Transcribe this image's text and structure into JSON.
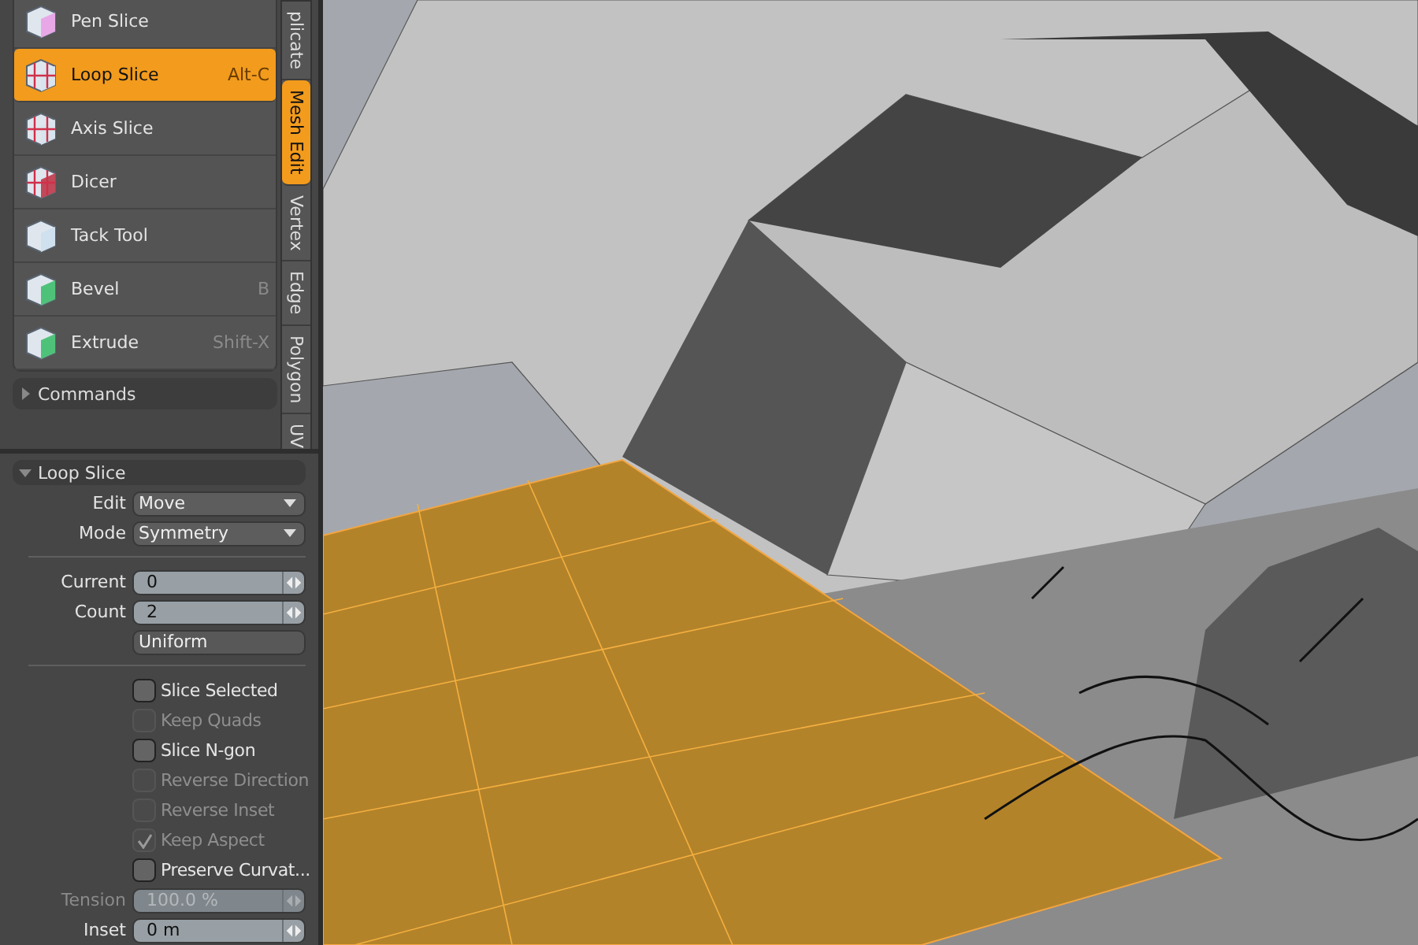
{
  "tools": [
    {
      "label": "Pen Slice",
      "selected": false
    },
    {
      "label": "Loop Slice",
      "shortcut": "Alt-C",
      "selected": true
    },
    {
      "label": "Axis Slice",
      "selected": false
    },
    {
      "label": "Dicer",
      "selected": false
    },
    {
      "label": "Tack Tool",
      "selected": false
    },
    {
      "label": "Bevel",
      "shortcut": "B",
      "selected": false
    },
    {
      "label": "Extrude",
      "shortcut": "Shift-X",
      "selected": false
    }
  ],
  "commands": {
    "label": "Commands",
    "expanded": false
  },
  "side_tabs": [
    {
      "label": "plicate",
      "selected": false
    },
    {
      "label": "Mesh Edit",
      "selected": true
    },
    {
      "label": "Vertex",
      "selected": false
    },
    {
      "label": "Edge",
      "selected": false
    },
    {
      "label": "Polygon",
      "selected": false
    },
    {
      "label": "UV",
      "selected": false
    }
  ],
  "properties": {
    "title": "Loop Slice",
    "expanded": true,
    "fields": [
      {
        "kind": "dropdown",
        "label": "Edit",
        "value": "Move"
      },
      {
        "kind": "dropdown",
        "label": "Mode",
        "value": "Symmetry"
      },
      {
        "kind": "divider"
      },
      {
        "kind": "number",
        "label": "Current",
        "value": "0",
        "disabled": false
      },
      {
        "kind": "number",
        "label": "Count",
        "value": "2",
        "disabled": false
      },
      {
        "kind": "button",
        "value": "Uniform"
      },
      {
        "kind": "divider"
      },
      {
        "kind": "checkbox",
        "value": "Slice Selected",
        "checked": false,
        "disabled": false
      },
      {
        "kind": "checkbox",
        "value": "Keep Quads",
        "checked": false,
        "disabled": true
      },
      {
        "kind": "checkbox",
        "value": "Slice N-gon",
        "checked": false,
        "disabled": false
      },
      {
        "kind": "checkbox",
        "value": "Reverse Direction",
        "checked": false,
        "disabled": true
      },
      {
        "kind": "checkbox",
        "value": "Reverse Inset",
        "checked": false,
        "disabled": true
      },
      {
        "kind": "checkbox",
        "value": "Keep Aspect",
        "checked": true,
        "disabled": true
      },
      {
        "kind": "checkbox",
        "value": "Preserve Curvat...",
        "checked": false,
        "disabled": false
      },
      {
        "kind": "number",
        "label": "Tension",
        "value": "100.0 %",
        "disabled": true
      },
      {
        "kind": "number",
        "label": "Inset",
        "value": "0 m",
        "disabled": false
      }
    ]
  }
}
